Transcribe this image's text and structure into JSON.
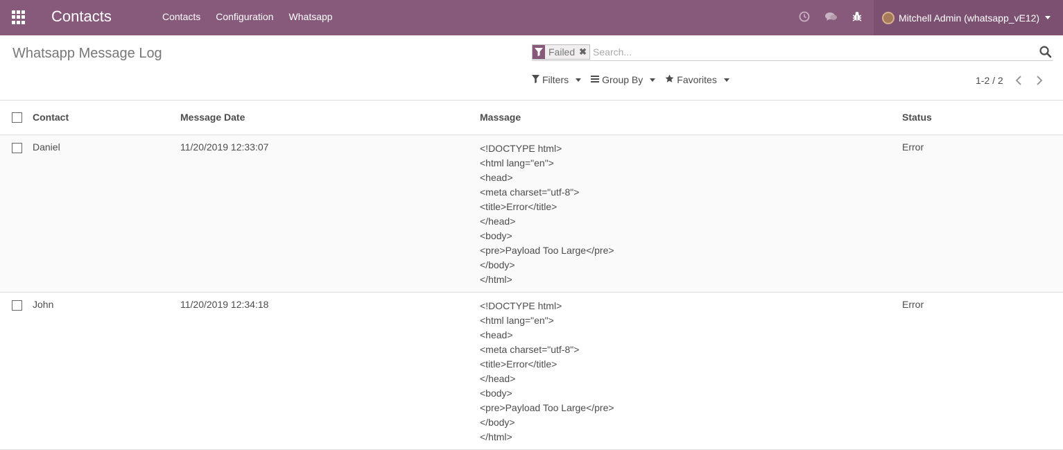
{
  "navbar": {
    "app_title": "Contacts",
    "menu": [
      "Contacts",
      "Configuration",
      "Whatsapp"
    ],
    "user": "Mitchell Admin (whatsapp_vE12)"
  },
  "control_panel": {
    "title": "Whatsapp Message Log",
    "facet": "Failed",
    "search_placeholder": "Search...",
    "filters_label": "Filters",
    "groupby_label": "Group By",
    "favorites_label": "Favorites",
    "pager": "1-2 / 2"
  },
  "table": {
    "headers": [
      "Contact",
      "Message Date",
      "Massage",
      "Status"
    ],
    "rows": [
      {
        "contact": "Daniel",
        "date": "11/20/2019 12:33:07",
        "message": [
          "<!DOCTYPE html>",
          "<html lang=\"en\">",
          "<head>",
          "<meta charset=\"utf-8\">",
          "<title>Error</title>",
          "</head>",
          "<body>",
          "<pre>Payload Too Large</pre>",
          "</body>",
          "</html>"
        ],
        "status": "Error"
      },
      {
        "contact": "John",
        "date": "11/20/2019 12:34:18",
        "message": [
          "<!DOCTYPE html>",
          "<html lang=\"en\">",
          "<head>",
          "<meta charset=\"utf-8\">",
          "<title>Error</title>",
          "</head>",
          "<body>",
          "<pre>Payload Too Large</pre>",
          "</body>",
          "</html>"
        ],
        "status": "Error"
      }
    ]
  },
  "colors": {
    "brand": "#875a7b",
    "brand_dark": "#7c5071"
  },
  "icons": {
    "apps": "grid-icon",
    "activity": "clock-icon",
    "chat": "chat-icon",
    "debug": "bug-icon",
    "filter": "filter-icon",
    "search": "search-icon"
  }
}
